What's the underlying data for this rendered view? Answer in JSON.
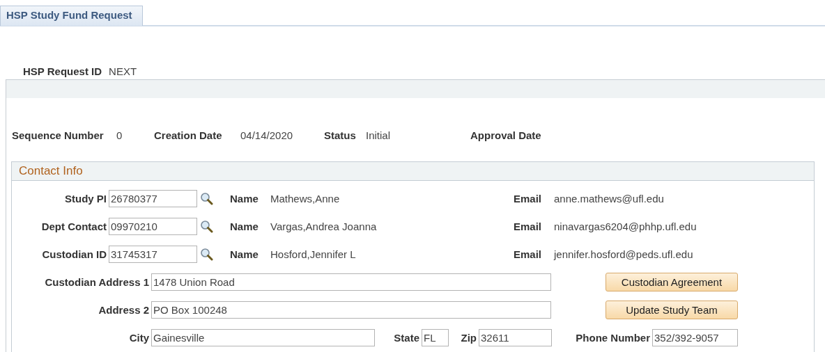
{
  "tabs": [
    {
      "label": "HSP Study Fund Request",
      "selected": true
    }
  ],
  "request_id": {
    "label": "HSP Request ID",
    "value": "NEXT"
  },
  "summary": [
    {
      "label": "Sequence Number",
      "value": "0"
    },
    {
      "label": "Creation Date",
      "value": "04/14/2020"
    },
    {
      "label": "Status",
      "value": "Initial"
    },
    {
      "label": "Approval Date"
    }
  ],
  "contact_info": {
    "title": "Contact Info",
    "contacts": [
      {
        "label": "Study PI",
        "value": "26780377",
        "name_label": "Name",
        "name": "Mathews,Anne",
        "email_label": "Email",
        "email": "anne.mathews@ufl.edu"
      },
      {
        "label": "Dept Contact",
        "value": "09970210",
        "name_label": "Name",
        "name": "Vargas,Andrea Joanna",
        "email_label": "Email",
        "email": "ninavargas6204@phhp.ufl.edu"
      },
      {
        "label": "Custodian ID",
        "value": "31745317",
        "name_label": "Name",
        "name": "Hosford,Jennifer L",
        "email_label": "Email",
        "email": "jennifer.hosford@peds.ufl.edu"
      }
    ],
    "address_1": {
      "label": "Custodian Address 1",
      "value": "1478 Union Road"
    },
    "address_2": {
      "label": "Address 2",
      "value": "PO Box 100248"
    },
    "buttons": [
      "Custodian Agreement",
      "Update Study Team"
    ],
    "city": {
      "label": "City",
      "value": "Gainesville"
    },
    "state": {
      "label": "State",
      "value": "FL"
    },
    "zip": {
      "label": "Zip",
      "value": "32611"
    },
    "phone": {
      "label": "Phone Number",
      "value": "352/392-9057"
    }
  }
}
